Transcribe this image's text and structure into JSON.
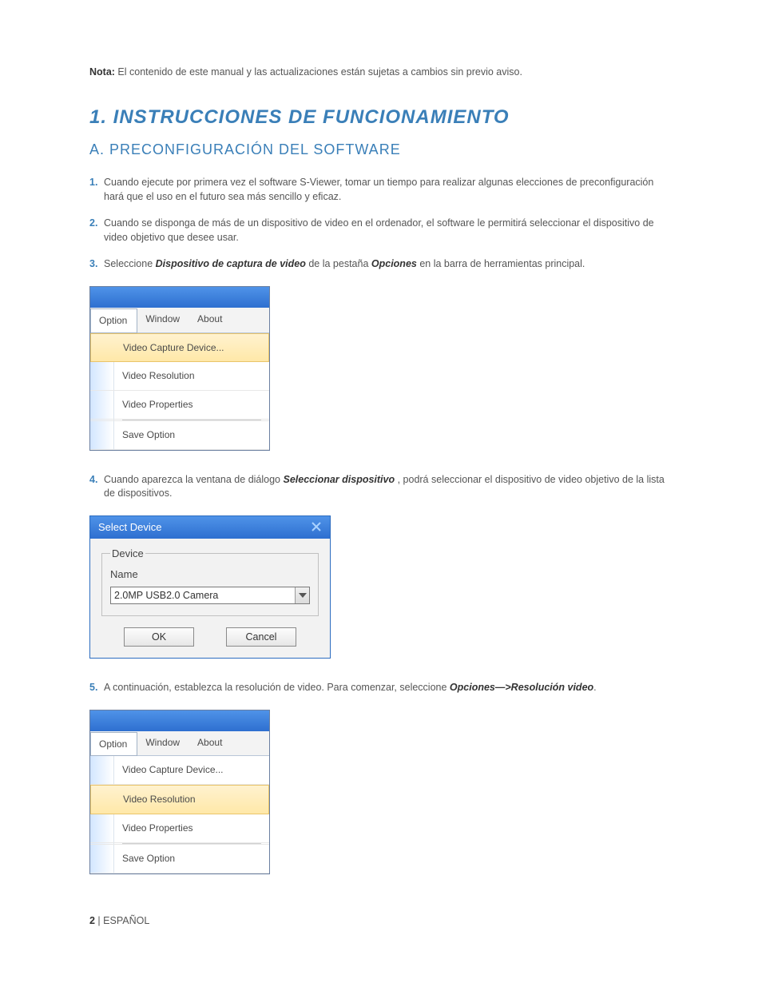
{
  "nota": {
    "label": "Nota:",
    "text": " El contenido de este manual y las actualizaciones están sujetas a cambios sin previo aviso."
  },
  "h1": "1. INSTRUCCIONES DE FUNCIONAMIENTO",
  "h2": "A. PRECONFIGURACIÓN DEL SOFTWARE",
  "steps": {
    "s1": {
      "num": "1.",
      "text": "Cuando ejecute por primera vez el software S-Viewer, tomar un tiempo para realizar algunas elecciones de preconfiguración hará que el uso en el futuro sea más sencillo y eficaz."
    },
    "s2": {
      "num": "2.",
      "text": "Cuando se disponga de más de un dispositivo de video en el ordenador, el software le permitirá  seleccionar el dispositivo de video objetivo que desee usar."
    },
    "s3": {
      "num": "3.",
      "pre": "Seleccione ",
      "b1": "Dispositivo de captura de video",
      "mid": " de la pestaña ",
      "b2": "Opciones",
      "post": " en la barra de herramientas principal."
    },
    "s4": {
      "num": "4.",
      "pre": "Cuando aparezca la ventana de diálogo ",
      "b1": "Seleccionar dispositivo",
      "post": " , podrá seleccionar el dispositivo de video objetivo de la lista de dispositivos."
    },
    "s5": {
      "num": "5.",
      "pre": "A continuación, establezca la resolución de video. Para comenzar, seleccione ",
      "b1": "Opciones—>Resolución video",
      "post": "."
    }
  },
  "menubar": {
    "option": "Option",
    "window": "Window",
    "about": "About"
  },
  "dropdown": {
    "capture": "Video Capture Device...",
    "resolution": "Video Resolution",
    "properties": "Video Properties",
    "save": "Save Option"
  },
  "dialog": {
    "title": "Select Device",
    "legend": "Device",
    "name_label": "Name",
    "combo_value": "2.0MP USB2.0 Camera",
    "ok": "OK",
    "cancel": "Cancel"
  },
  "footer": {
    "page": "2",
    "sep": " | ",
    "lang": "ESPAÑOL"
  }
}
